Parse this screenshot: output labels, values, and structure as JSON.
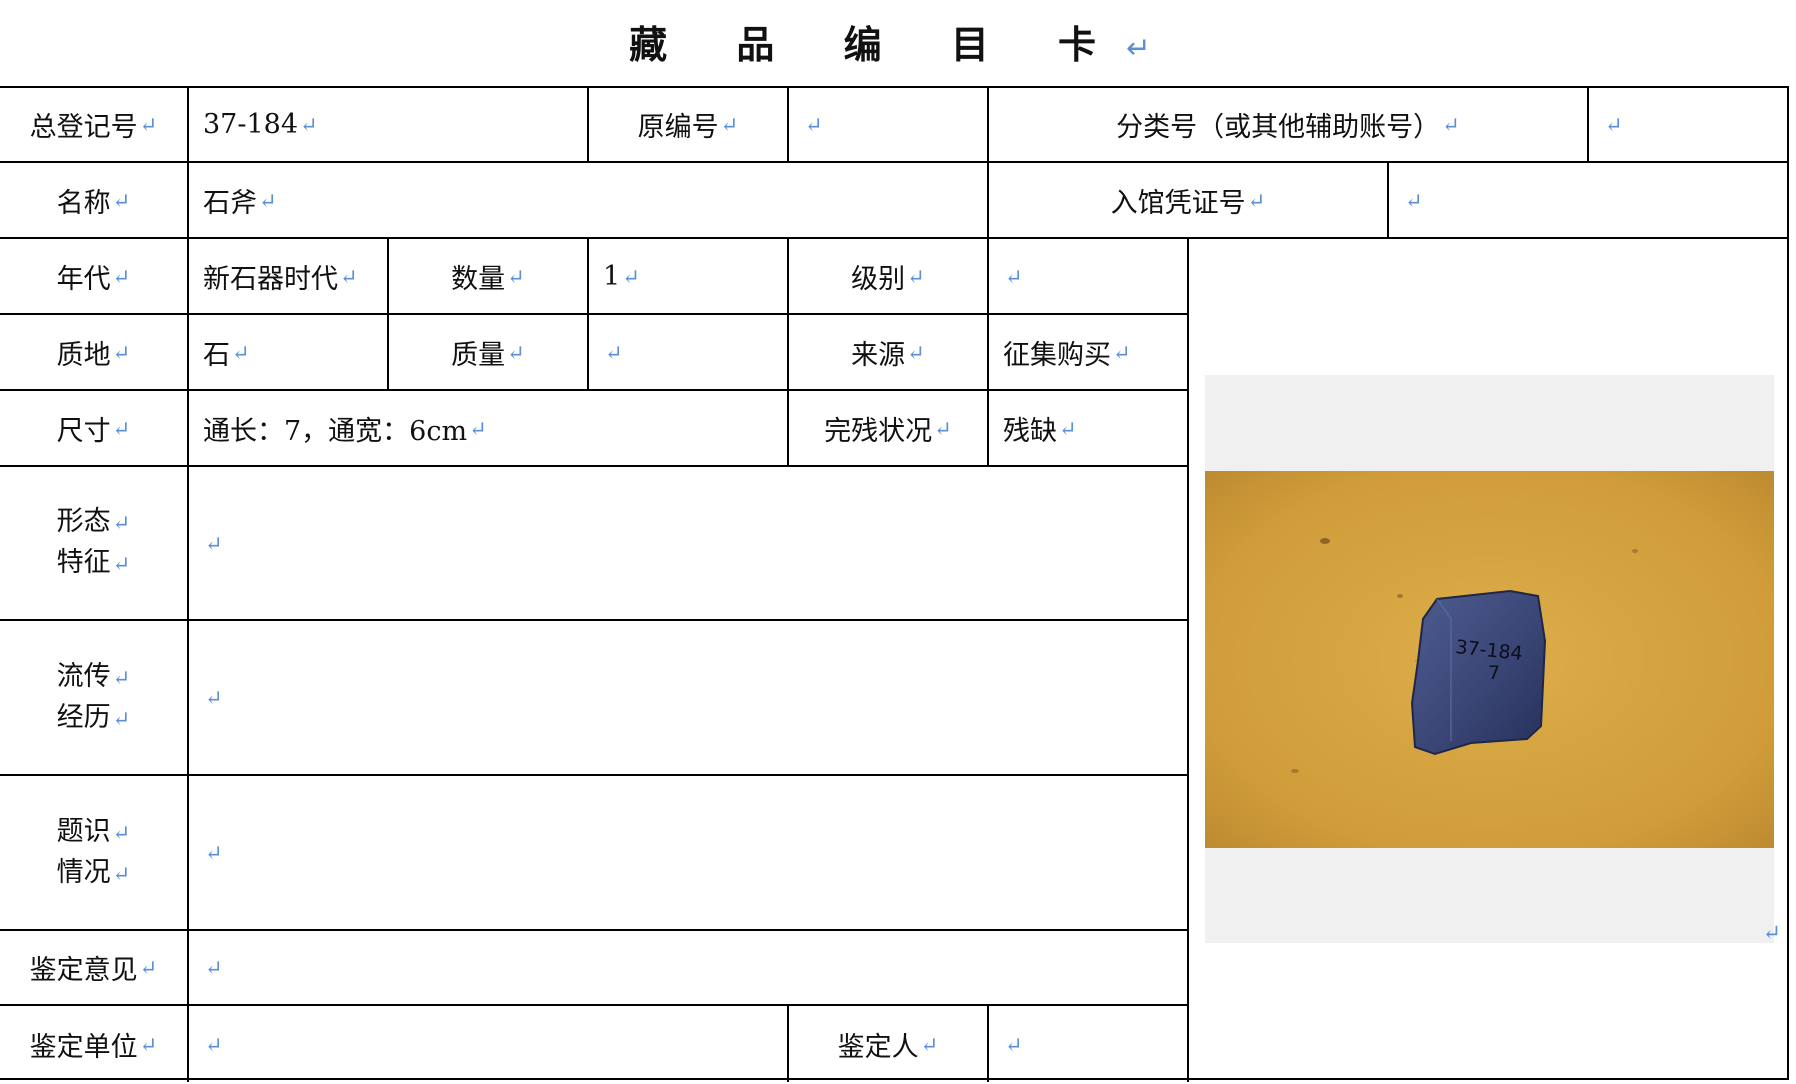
{
  "title": "藏 品 编 目 卡",
  "mark": "↵",
  "row1": {
    "reg_no_label": "总登记号",
    "reg_no_value": "37-184",
    "orig_no_label": "原编号",
    "orig_no_value": "",
    "class_no_label": "分类号（或其他辅助账号）",
    "class_no_value": ""
  },
  "row2": {
    "name_label": "名称",
    "name_value": "石斧",
    "voucher_label": "入馆凭证号",
    "voucher_value": ""
  },
  "row3": {
    "era_label": "年代",
    "era_value": "新石器时代",
    "qty_label": "数量",
    "qty_value": "1",
    "grade_label": "级别",
    "grade_value": ""
  },
  "row4": {
    "material_label": "质地",
    "material_value": "石",
    "mass_label": "质量",
    "mass_value": "",
    "source_label": "来源",
    "source_value": "征集购买"
  },
  "row5": {
    "size_label": "尺寸",
    "size_value": "通长：7，通宽：6cm",
    "condition_label": "完残状况",
    "condition_value": "残缺"
  },
  "row6": {
    "label_1": "形态",
    "label_2": "特征",
    "value": ""
  },
  "row7": {
    "label_1": "流传",
    "label_2": "经历",
    "value": ""
  },
  "row8": {
    "label_1": "题识",
    "label_2": "情况",
    "value": ""
  },
  "row9": {
    "opinion_label": "鉴定意见",
    "opinion_value": ""
  },
  "row10": {
    "unit_label": "鉴定单位",
    "unit_value": "",
    "appraiser_label": "鉴定人",
    "appraiser_value": ""
  },
  "photo": {
    "marking_1": "37-184",
    "marking_2": "7",
    "background_color": "#d7a53e",
    "object_color": "#3c4a78"
  }
}
